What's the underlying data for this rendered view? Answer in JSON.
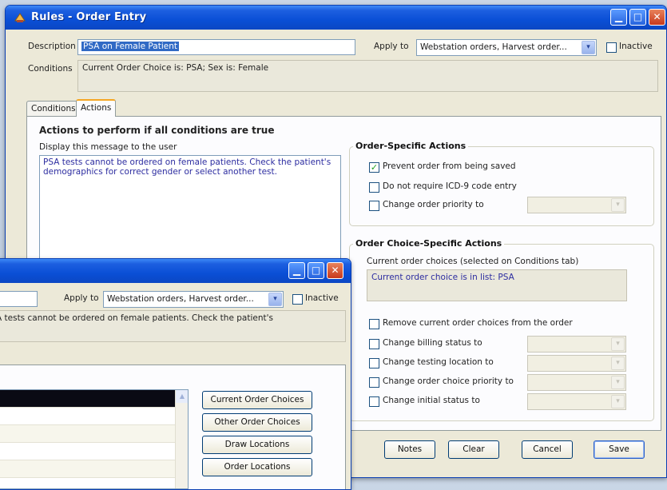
{
  "main": {
    "title": "Rules - Order Entry",
    "description_label": "Description",
    "description_value": "PSA on Female Patient",
    "apply_to_label": "Apply to",
    "apply_to_value": "Webstation orders, Harvest order...",
    "inactive_label": "Inactive",
    "conditions_label": "Conditions",
    "conditions_value": "Current Order Choice is: PSA;  Sex is:  Female",
    "tabs": [
      {
        "label": "Conditions"
      },
      {
        "label": "Actions"
      }
    ],
    "actions_heading": "Actions to perform if all conditions are true",
    "message_label": "Display this message to the user",
    "message_value": "PSA tests cannot be ordered on female patients. Check the patient's demographics for correct gender or select another test.",
    "order_specific": {
      "title": "Order-Specific Actions",
      "prevent_save": {
        "label": "Prevent order from being saved",
        "checked": true
      },
      "no_icd9": {
        "label": "Do not require ICD-9 code entry",
        "checked": false
      },
      "change_priority": {
        "label": "Change order priority to",
        "checked": false
      }
    },
    "choice_specific": {
      "title": "Order Choice-Specific Actions",
      "current_label": "Current order choices (selected on Conditions tab)",
      "current_value": "Current order choice is in list: PSA",
      "remove": {
        "label": "Remove current order choices from the order",
        "checked": false
      },
      "billing": {
        "label": "Change billing status to",
        "checked": false
      },
      "location": {
        "label": "Change testing location to",
        "checked": false
      },
      "choice_priority": {
        "label": "Change order choice priority to",
        "checked": false
      },
      "initial_status": {
        "label": "Change initial status to",
        "checked": false
      }
    },
    "buttons": {
      "notes": "Notes",
      "clear": "Clear",
      "cancel": "Cancel",
      "save": "Save"
    }
  },
  "front": {
    "apply_to_label": "Apply to",
    "apply_to_value": "Webstation orders, Harvest order...",
    "inactive_label": "Inactive",
    "conditions_value": "A tests cannot be ordered on female patients. Check the patient's",
    "buttons": {
      "current": "Current Order Choices",
      "other": "Other Order Choices",
      "draw": "Draw Locations",
      "order_loc": "Order Locations"
    }
  },
  "icons": {
    "check": "✓",
    "dropdown": "▾",
    "minimize": "▁",
    "maximize": "□",
    "close": "✕"
  },
  "colors": {
    "titlebar": "#0a4fd6",
    "selection": "#316ac5",
    "readonly_text": "#2c2ca0",
    "tab_accent": "#f5a623"
  }
}
